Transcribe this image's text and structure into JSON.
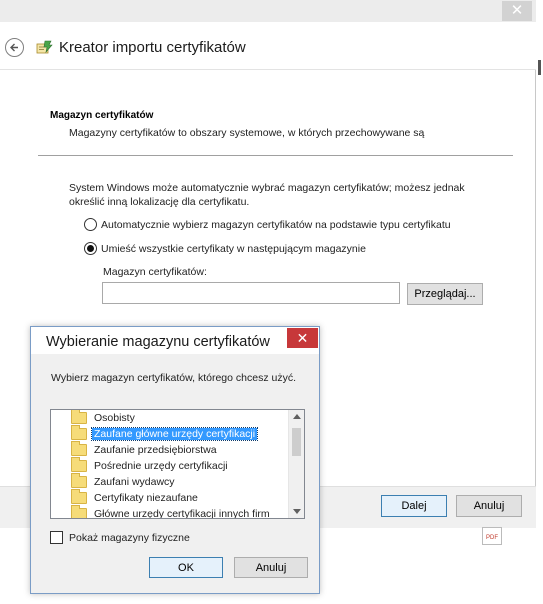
{
  "wizard": {
    "close_glyph": "✕",
    "title": "Kreator importu certyfikatów",
    "section_title": "Magazyn certyfikatów",
    "section_description": "Magazyny certyfikatów to obszary systemowe, w których przechowywane są",
    "intro_text": "System Windows może automatycznie wybrać magazyn certyfikatów; możesz jednak określić inną lokalizację dla certyfikatu.",
    "options": [
      {
        "label": "Automatycznie wybierz magazyn certyfikatów na podstawie typu certyfikatu",
        "checked": false
      },
      {
        "label": "Umieść wszystkie certyfikaty w następującym magazynie",
        "checked": true
      }
    ],
    "store_label": "Magazyn certyfikatów:",
    "store_value": "",
    "browse_label": "Przeglądaj...",
    "next_label": "Dalej",
    "cancel_label": "Anuluj"
  },
  "dialog": {
    "title": "Wybieranie magazynu certyfikatów",
    "close_glyph": "✕",
    "prompt": "Wybierz magazyn certyfikatów, którego chcesz użyć.",
    "stores": [
      {
        "label": "Osobisty",
        "selected": false
      },
      {
        "label": "Zaufane główne urzędy certyfikacji",
        "selected": true
      },
      {
        "label": "Zaufanie przedsiębiorstwa",
        "selected": false
      },
      {
        "label": "Pośrednie urzędy certyfikacji",
        "selected": false
      },
      {
        "label": "Zaufani wydawcy",
        "selected": false
      },
      {
        "label": "Certyfikaty niezaufane",
        "selected": false
      },
      {
        "label": "Główne urzędy certyfikacji innych firm",
        "selected": false
      }
    ],
    "show_physical_label": "Pokaż magazyny fizyczne",
    "show_physical_checked": false,
    "ok_label": "OK",
    "cancel_label": "Anuluj"
  },
  "background": {
    "pdf_label": "PDF"
  },
  "colors": {
    "dialog_close": "#c7383a",
    "selection": "#3399ff",
    "folder": "#f6dc79",
    "default_button_border": "#3c7fb1"
  }
}
